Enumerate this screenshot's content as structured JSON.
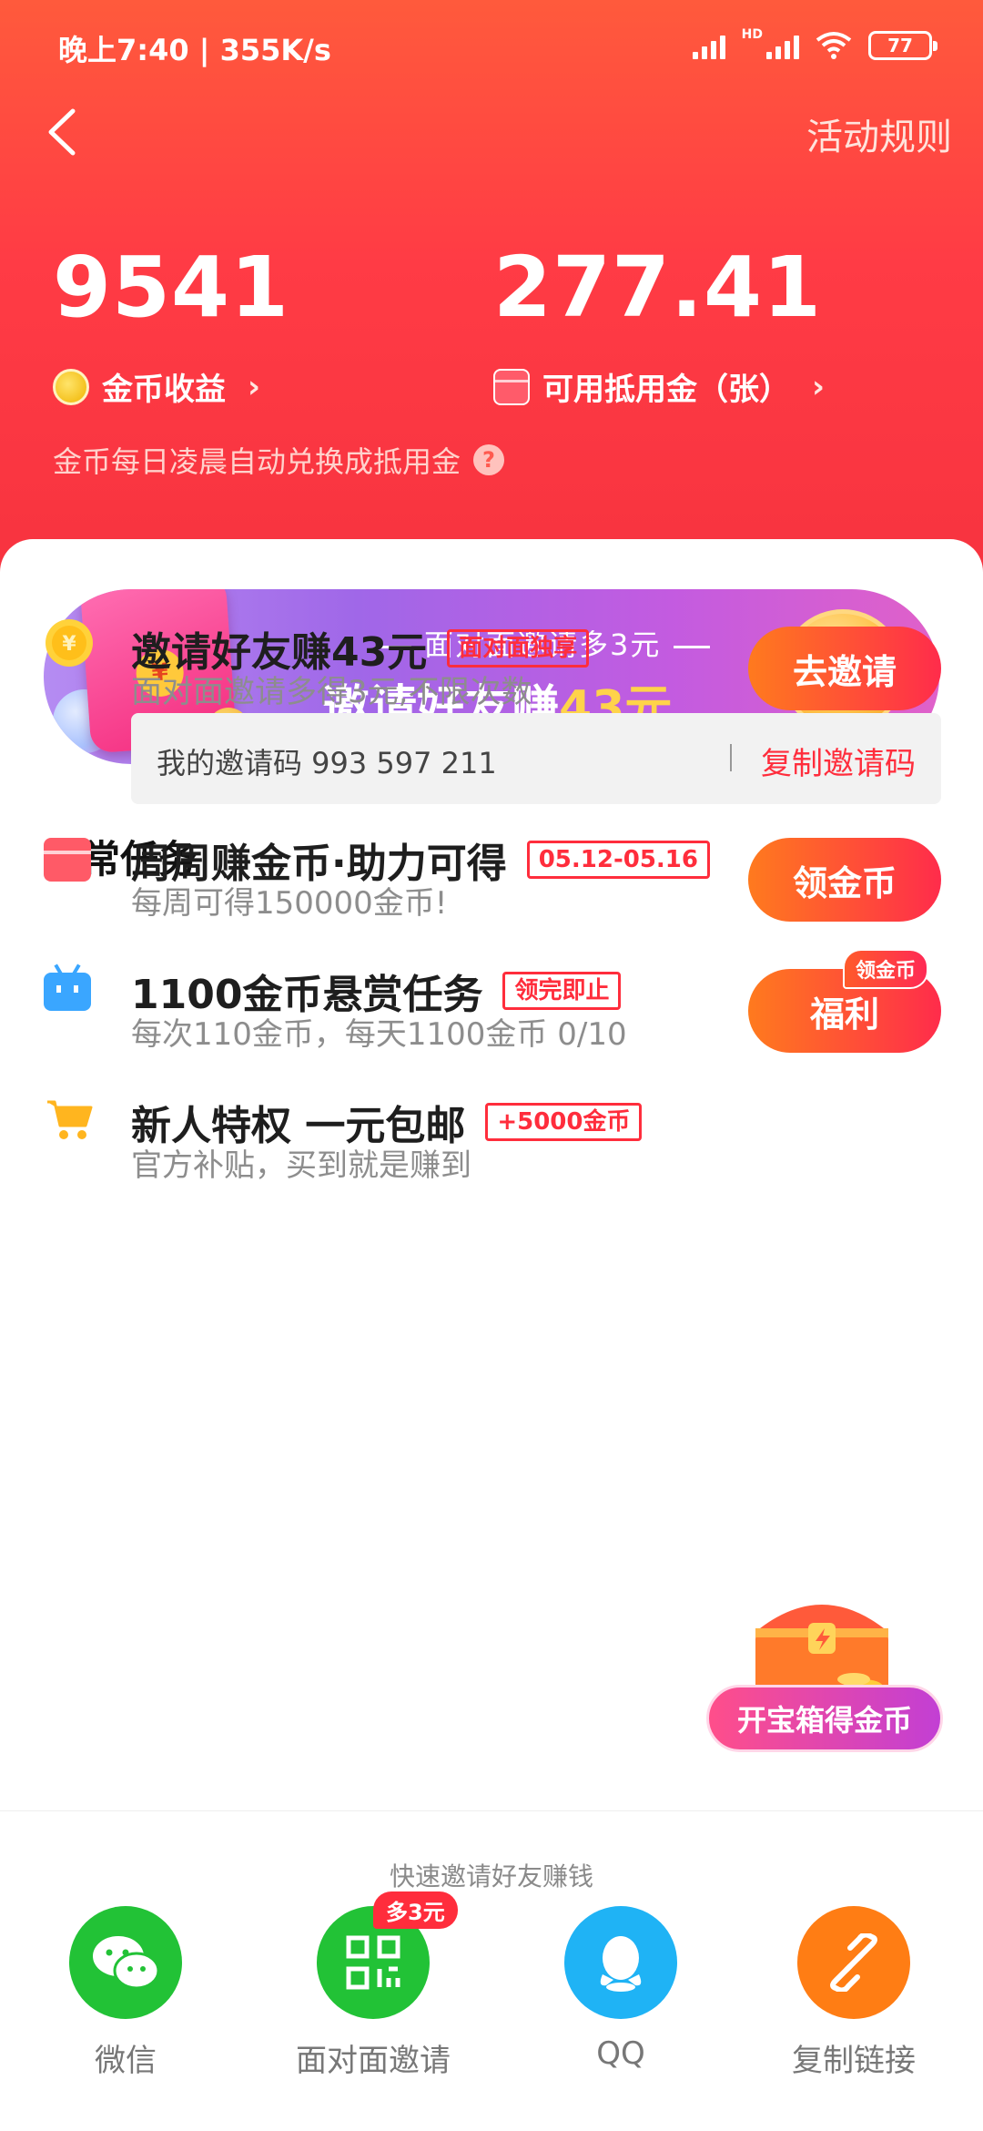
{
  "status": {
    "time": "晚上7:40 | 355K/s",
    "battery": "77",
    "hd": "HD"
  },
  "nav": {
    "rules": "活动规则"
  },
  "stats": {
    "coins_value": "9541",
    "coins_label": "金币收益",
    "voucher_value": "277.41",
    "voucher_label": "可用抵用金（张）",
    "note": "金币每日凌晨自动兑换成抵用金"
  },
  "banner": {
    "subtitle": "面对面邀请多3元",
    "title_prefix": "邀请好友赚",
    "title_amount": "43元",
    "coin_text": "领",
    "seal_text": "¥",
    "page_count": 3,
    "active_index": 0
  },
  "daily": {
    "title": "日常任务",
    "tasks": [
      {
        "title": "邀请好友赚43元",
        "tag": "面对面独享",
        "desc": "面对面邀请多得3元,不限次数",
        "button": "去邀请",
        "icon": "coin-icon"
      },
      {
        "title": "周周赚金币·助力可得",
        "tag": "05.12-05.16",
        "desc": "每周可得150000金币!",
        "button": "领金币",
        "icon": "red-packet-icon"
      },
      {
        "title": "1100金币悬赏任务",
        "tag": "领完即止",
        "desc": "每次110金币，每天1100金币 0/10",
        "button": "福利",
        "badge": "领金币",
        "icon": "tv-icon"
      },
      {
        "title": "新人特权 一元包邮",
        "tag": "+5000金币",
        "desc": "官方补贴，买到就是赚到",
        "icon": "cart-icon"
      }
    ],
    "invite_code_text": "我的邀请码 993 597 211",
    "copy_code": "复制邀请码"
  },
  "chest": {
    "label": "开宝箱得金币"
  },
  "share": {
    "title": "快速邀请好友赚钱",
    "items": [
      {
        "label": "微信",
        "color": "#22c236"
      },
      {
        "label": "面对面邀请",
        "color": "#22c236",
        "badge": "多3元"
      },
      {
        "label": "QQ",
        "color": "#1fb3f5"
      },
      {
        "label": "复制链接",
        "color": "#ff7d14"
      }
    ]
  },
  "colors": {
    "header_red": "#ff3b45",
    "accent": "#ff2d3c",
    "button_gradient": [
      "#ff7a1e",
      "#ff2c4b"
    ]
  }
}
